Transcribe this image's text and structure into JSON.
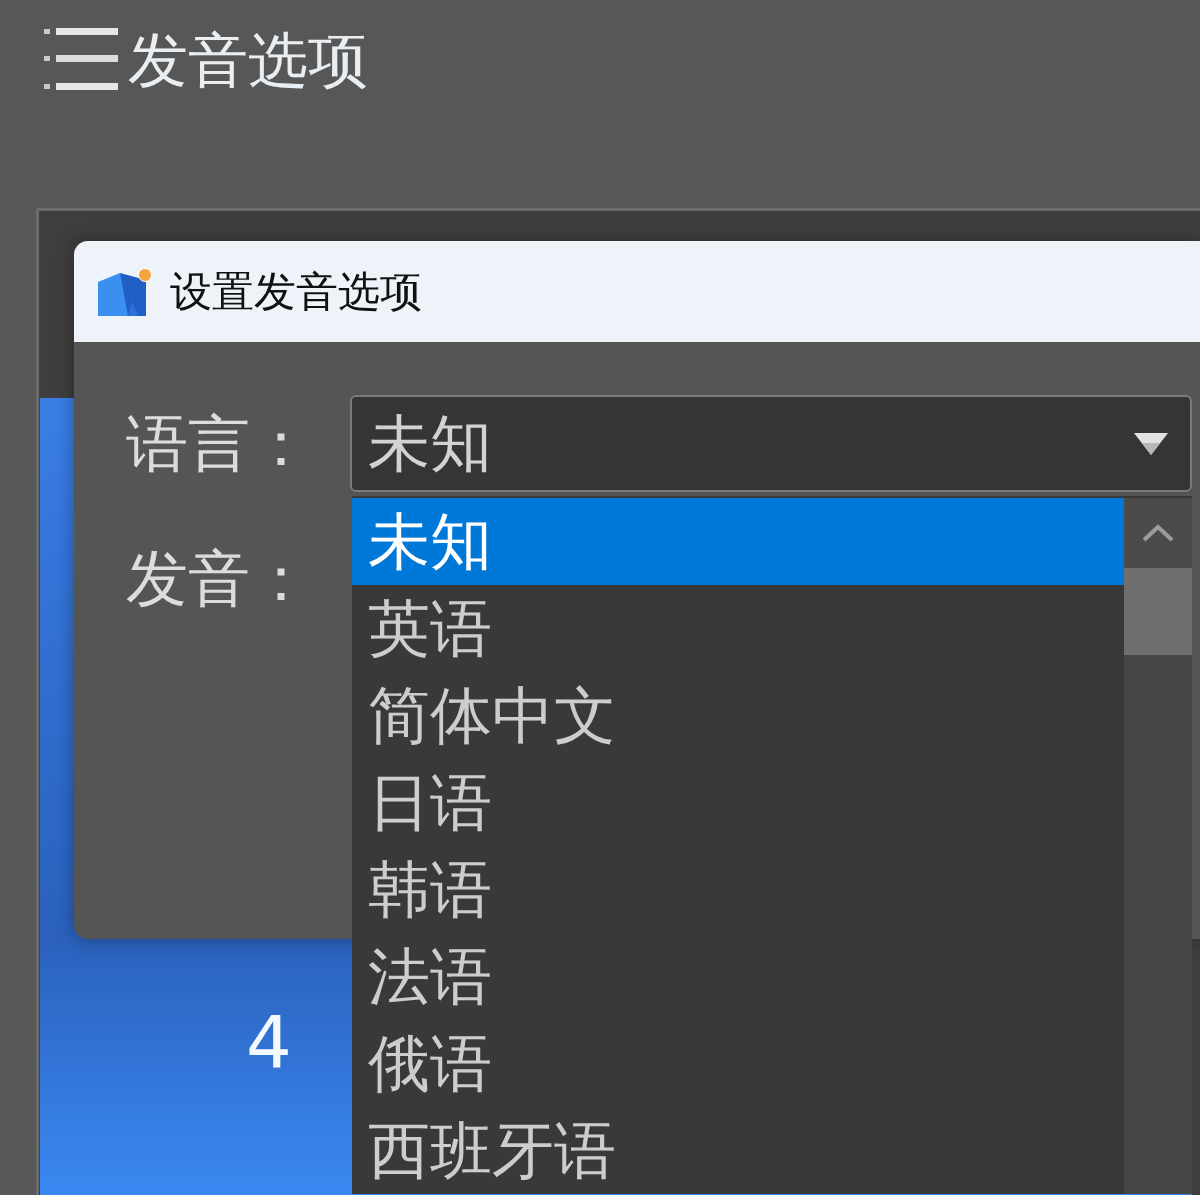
{
  "header": {
    "title": "发音选项"
  },
  "background_panel": {
    "text": "4"
  },
  "dialog": {
    "title": "设置发音选项",
    "rows": [
      {
        "kind": "dropdown",
        "label": "语言：",
        "value": "未知",
        "expanded": true,
        "options": [
          {
            "label": "未知",
            "selected": true
          },
          {
            "label": "英语",
            "selected": false
          },
          {
            "label": "简体中文",
            "selected": false
          },
          {
            "label": "日语",
            "selected": false
          },
          {
            "label": "韩语",
            "selected": false
          },
          {
            "label": "法语",
            "selected": false
          },
          {
            "label": "俄语",
            "selected": false
          },
          {
            "label": "西班牙语",
            "selected": false
          }
        ]
      },
      {
        "kind": "label",
        "label": "发音："
      }
    ]
  }
}
